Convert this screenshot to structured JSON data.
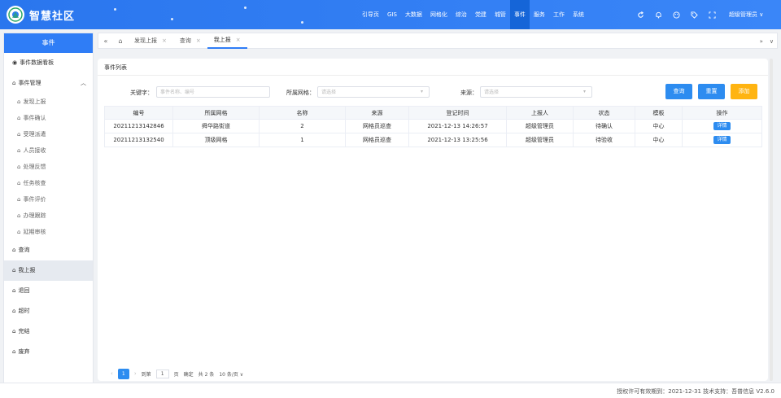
{
  "header": {
    "app_title": "智慧社区",
    "nav": [
      "引导页",
      "GIS",
      "大数据",
      "网格化",
      "综治",
      "党建",
      "城管",
      "事件",
      "服务",
      "工作",
      "系统"
    ],
    "active_nav_index": 7,
    "user": "超级管理员 ∨"
  },
  "sidebar": {
    "title": "事件",
    "dashboard": "事件数据看板",
    "manage_group": "事件管理",
    "manage_items": [
      "发现上报",
      "事件确认",
      "受理派遣",
      "人员接收",
      "处理反馈",
      "任务核查",
      "事件评价",
      "办理跟踪",
      "延期审核"
    ],
    "bottom_items": [
      "查询",
      "我上报",
      "退回",
      "超时",
      "完结",
      "废弃"
    ],
    "active_item": "我上报"
  },
  "tabs": {
    "items": [
      "发现上报",
      "查询",
      "我上报"
    ],
    "active_index": 2
  },
  "panel": {
    "title": "事件列表",
    "form": {
      "keyword_label": "关键字：",
      "keyword_placeholder": "事件名称、编号",
      "grid_label": "所属网格：",
      "grid_placeholder": "请选择",
      "source_label": "来源：",
      "source_placeholder": "请选择"
    },
    "buttons": {
      "query": "查询",
      "reset": "重置",
      "add": "添加"
    },
    "table": {
      "headers": [
        "编号",
        "所属网格",
        "名称",
        "来源",
        "登记时间",
        "上报人",
        "状态",
        "模板",
        "操作"
      ],
      "rows": [
        [
          "20211213142846",
          "舜华路街道",
          "2",
          "网格员巡查",
          "2021-12-13 14:26:57",
          "超级管理员",
          "待确认",
          "中心",
          "详情"
        ],
        [
          "20211213132540",
          "顶级网格",
          "1",
          "网格员巡查",
          "2021-12-13 13:25:56",
          "超级管理员",
          "待验收",
          "中心",
          "详情"
        ]
      ]
    },
    "pager": {
      "current": "1",
      "goto_label": "到第",
      "goto_value": "1",
      "page_unit": "页",
      "confirm": "确定",
      "total": "共 2 条",
      "page_size": "10 条/页 ∨"
    }
  },
  "footer": {
    "text": "授权许可有效期到：2021-12-31  技术支持：吾普信息  V2.6.0"
  },
  "colors": {
    "primary": "#2f7df6",
    "active_nav": "#1565d8",
    "warning": "#ff9a2e",
    "add": "#ffb411"
  }
}
